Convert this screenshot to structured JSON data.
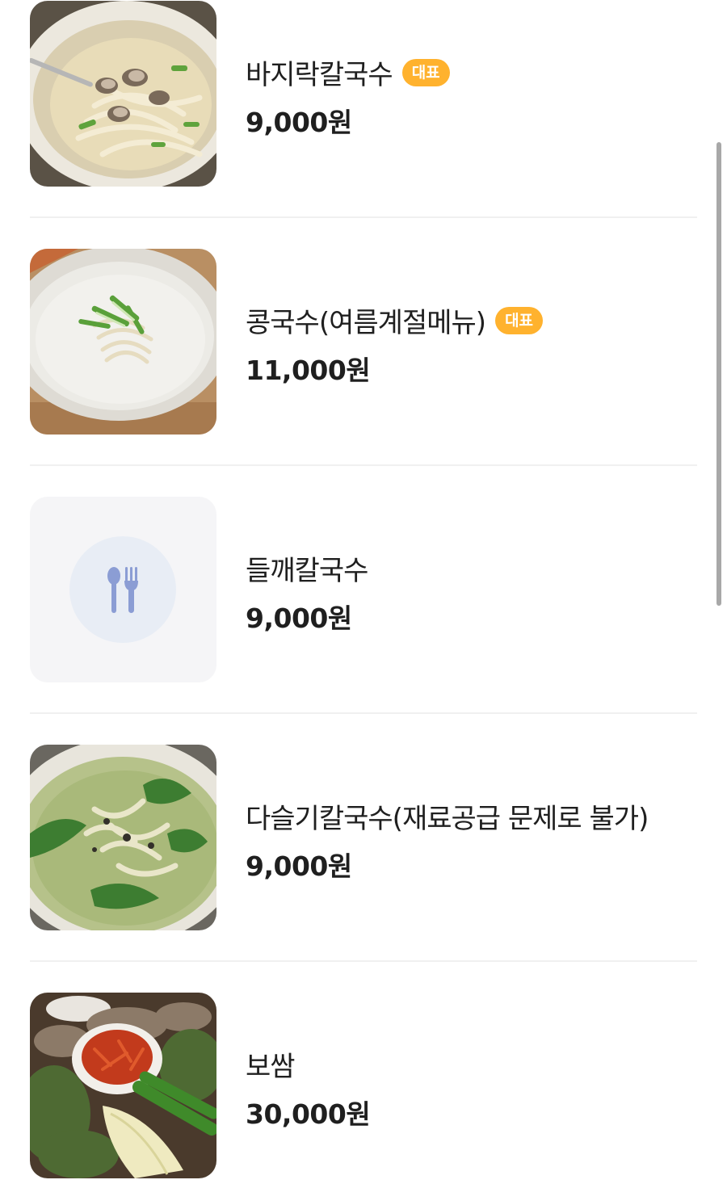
{
  "menu": {
    "items": [
      {
        "name": "바지락칼국수",
        "badge": "대표",
        "price": "9,000원",
        "image": "clam-kalguksu-photo"
      },
      {
        "name": "콩국수(여름계절메뉴)",
        "badge": "대표",
        "price": "11,000원",
        "image": "kongguksu-photo"
      },
      {
        "name": "들깨칼국수",
        "badge": "",
        "price": "9,000원",
        "image": "fork-spoon-placeholder-icon"
      },
      {
        "name": "다슬기칼국수(재료공급 문제로 불가)",
        "badge": "",
        "price": "9,000원",
        "image": "daseulgi-kalguksu-photo"
      },
      {
        "name": "보쌈",
        "badge": "",
        "price": "30,000원",
        "image": "bossam-photo"
      }
    ]
  },
  "colors": {
    "badge": "#ffb22e",
    "placeholder_bg": "#f5f5f7",
    "placeholder_circle": "#e8edf5",
    "utensil_icon": "#8b9dd4",
    "divider": "#f0f0f0"
  }
}
